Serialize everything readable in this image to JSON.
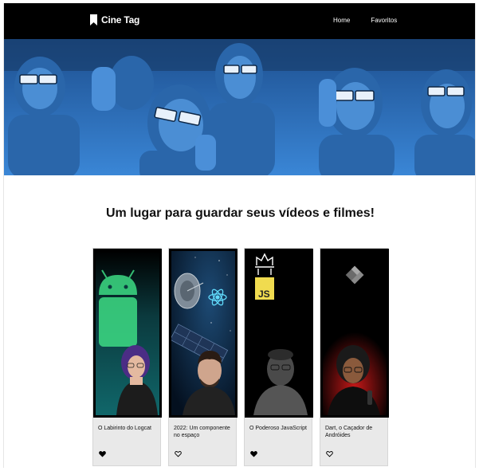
{
  "app": {
    "logo_text": "Cine Tag",
    "nav": [
      "Home",
      "Favoritos"
    ]
  },
  "headline": "Um lugar para guardar seus vídeos e filmes!",
  "videos": [
    {
      "title": "O Labirinto do Logcat",
      "favorite": true
    },
    {
      "title": "2022: Um componente no espaço",
      "favorite": false
    },
    {
      "title": "O Poderoso JavaScript",
      "favorite": true
    },
    {
      "title": "Dart, o Caçador de Andróides",
      "favorite": false
    }
  ],
  "thumb_badges": {
    "js": "JS"
  },
  "colors": {
    "header_bg": "#000000",
    "banner_blue": "#2f6fb6",
    "card_bg": "#e9e9e9",
    "android_green": "#3ddc84",
    "react_cyan": "#61dafb",
    "js_yellow": "#f0db4f",
    "dart_red": "#c41818"
  },
  "icons": {
    "logo": "bookmark-icon",
    "favorite_on": "heart-filled-icon",
    "favorite_off": "heart-outline-icon"
  }
}
